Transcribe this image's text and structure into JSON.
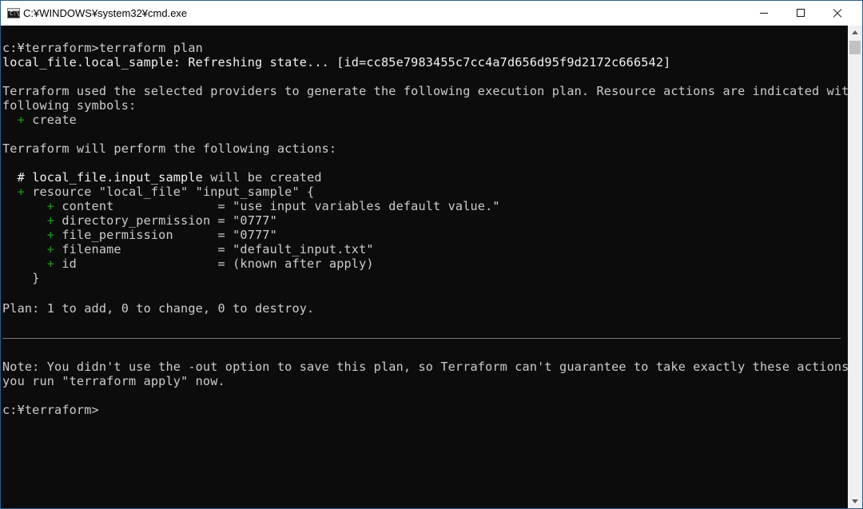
{
  "window": {
    "title": "C:¥WINDOWS¥system32¥cmd.exe",
    "icon_label": "C:\\",
    "controls": [
      "minimize-icon",
      "maximize-icon",
      "close-icon"
    ]
  },
  "console": {
    "background_color": "#0c0c0c",
    "text_color": "#cccccc",
    "accent_green": "#13a10e",
    "lines": [
      "c:¥terraform>terraform plan",
      "local_file.local_sample: Refreshing state... [id=cc85e7983455c7cc4a7d656d95f9d2172c666542]",
      "Terraform used the selected providers to generate the following execution plan. Resource actions are indicated with the",
      "following symbols:",
      "  + create",
      "Terraform will perform the following actions:",
      "  # local_file.input_sample will be created",
      "  + resource \"local_file\" \"input_sample\" {",
      "      + content              = \"use input variables default value.\"",
      "      + directory_permission = \"0777\"",
      "      + file_permission      = \"0777\"",
      "      + filename             = \"default_input.txt\"",
      "      + id                   = (known after apply)",
      "    }",
      "Plan: 1 to add, 0 to change, 0 to destroy.",
      "Note: You didn't use the -out option to save this plan, so Terraform can't guarantee to take exactly these actions if",
      "you run \"terraform apply\" now.",
      "c:¥terraform>"
    ],
    "parts": {
      "plus": "+",
      "create_word": "create",
      "plan_comment_hash": "#",
      "plan_comment_resource": "local_file.input_sample",
      "plan_comment_rest": " will be created",
      "resource_line_rest": "resource \"local_file\" \"input_sample\" {",
      "attr_content": "content              = \"use input variables default value.\"",
      "attr_directory_permission": "directory_permission = \"0777\"",
      "attr_file_permission": "file_permission      = \"0777\"",
      "attr_filename": "filename             = \"default_input.txt\"",
      "attr_id": "id                   = (known after apply)",
      "closing_brace": "}"
    }
  }
}
